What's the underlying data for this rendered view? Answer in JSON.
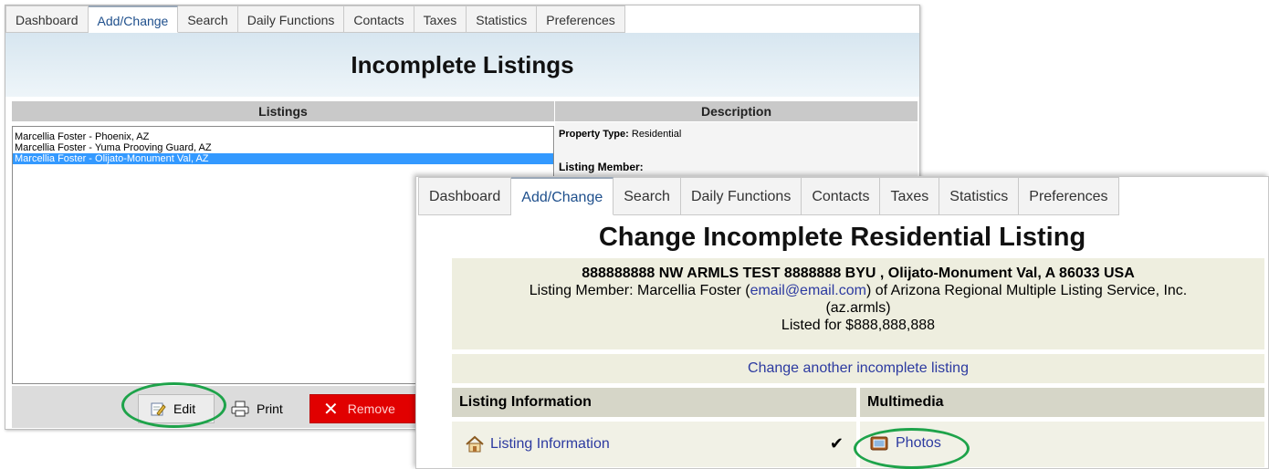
{
  "tabs": [
    "Dashboard",
    "Add/Change",
    "Search",
    "Daily Functions",
    "Contacts",
    "Taxes",
    "Statistics",
    "Preferences"
  ],
  "active_tab": "Add/Change",
  "back_panel": {
    "title": "Incomplete Listings",
    "listings_header": "Listings",
    "description_header": "Description",
    "listings": [
      "Marcellia Foster - Phoenix, AZ",
      "Marcellia Foster - Yuma Prooving Guard, AZ",
      "Marcellia Foster - Olijato-Monument Val, AZ"
    ],
    "selected_index": 2,
    "property_type_label": "Property Type:",
    "property_type_value": "Residential",
    "listing_member_label": "Listing Member:",
    "buttons": {
      "edit": "Edit",
      "print": "Print",
      "remove": "Remove"
    }
  },
  "front_panel": {
    "title": "Change Incomplete Residential Listing",
    "address": "888888888 NW ARMLS TEST 8888888 BYU , Olijato-Monument Val, A 86033 USA",
    "member_prefix": "Listing Member: Marcellia Foster (",
    "member_email": "email@email.com",
    "member_suffix": ") of Arizona Regional Multiple Listing Service, Inc.",
    "member_org_code": "(az.armls)",
    "listed_for": "Listed for $888,888,888",
    "change_link": "Change another incomplete listing",
    "listing_info_header": "Listing Information",
    "multimedia_header": "Multimedia",
    "listing_info_link": "Listing Information",
    "photos_link": "Photos",
    "check_mark": "✔"
  },
  "colors": {
    "highlight": "#1ea34a",
    "selection": "#3399ff",
    "remove": "#e10000",
    "link": "#2c3aa0"
  }
}
